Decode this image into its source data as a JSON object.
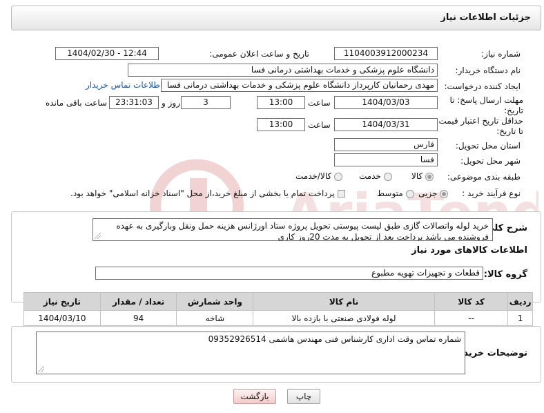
{
  "header": {
    "title": "جزئیات اطلاعات نیاز"
  },
  "form": {
    "need_number_label": "شماره نیاز:",
    "need_number": "1104003912000234",
    "announce_label": "تاریخ و ساعت اعلان عمومی:",
    "announce_value": "1404/02/30 - 12:44",
    "buyer_label": "نام دستگاه خریدار:",
    "buyer_value": "دانشگاه علوم پزشکی و خدمات بهداشتی درمانی فسا",
    "creator_label": "ایجاد کننده درخواست:",
    "creator_value": "مهدی رحمانیان کارپرداز دانشگاه علوم پزشکی و خدمات بهداشتی درمانی فسا",
    "buyer_contact_link": "اطلاعات تماس خریدار",
    "reply_deadline_label": "مهلت ارسال پاسخ: تا تاریخ:",
    "reply_date": "1404/03/03",
    "time_label": "ساعت",
    "reply_time": "13:00",
    "days_count": "3",
    "days_label": "روز و",
    "remaining_time": "23:31:03",
    "remaining_label": "ساعت باقی مانده",
    "min_validity_label": "حداقل تاریخ اعتبار قیمت: تا تاریخ:",
    "validity_date": "1404/03/31",
    "validity_time": "13:00",
    "province_label": "استان محل تحویل:",
    "province_value": "فارس",
    "city_label": "شهر محل تحویل:",
    "city_value": "فسا",
    "category_label": "طبقه بندی موضوعی:",
    "category_options": [
      "کالا",
      "خدمت",
      "کالا/خدمت"
    ],
    "category_selected": "کالا",
    "process_label": "نوع فرآیند خرید :",
    "process_options": [
      "جزیی",
      "متوسط"
    ],
    "process_selected": "جزیی",
    "payment_note": "پرداخت تمام یا بخشی از مبلغ خرید،از محل \"اسناد خزانه اسلامی\" خواهد بود."
  },
  "description": {
    "label": "شرح کلی نیاز:",
    "text": "خرید لوله واتصالات گازی طبق لیست پیوستی تحویل پروژه ستاد اورژانس هزینه حمل ونقل وبارگیری به عهده فروشنده می باشد پرداخت بعد از تحویل به مدت 20روز کاری"
  },
  "goods": {
    "section_title": "اطلاعات کالاهای مورد نیاز",
    "group_label": "گروه کالا:",
    "group_value": "قطعات و تجهیزات تهویه مطبوع",
    "columns": [
      "ردیف",
      "کد کالا",
      "نام کالا",
      "واحد شمارش",
      "تعداد / مقدار",
      "تاریخ نیاز"
    ],
    "rows": [
      [
        "1",
        "--",
        "لوله فولادی صنعتی با بازده بالا",
        "شاخه",
        "94",
        "1404/03/10"
      ]
    ]
  },
  "buyer_notes": {
    "label": "توضیحات خریدار:",
    "text": "شماره تماس  وقت اداری کارشناس فنی مهندس هاشمی 09352926514"
  },
  "buttons": {
    "print": "چاپ",
    "back": "بازگشت"
  },
  "watermark": {
    "brand": "AriaTender.neT"
  },
  "colors": {
    "link": "#1a56b0",
    "header_bg": "#e6e6e6",
    "table_head": "#d6d6d6",
    "back_button": "#f3caca",
    "watermark": "#f1d6d6"
  }
}
